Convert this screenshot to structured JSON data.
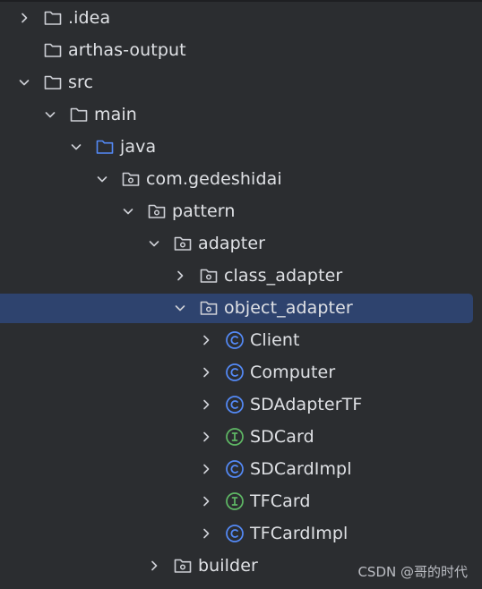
{
  "tree": [
    {
      "label": ".idea",
      "icon": "folder-icon",
      "chevron": "right",
      "depth": 0
    },
    {
      "label": "arthas-output",
      "icon": "folder-icon",
      "chevron": "none",
      "depth": 0
    },
    {
      "label": "src",
      "icon": "folder-icon",
      "chevron": "down",
      "depth": 0
    },
    {
      "label": "main",
      "icon": "folder-icon",
      "chevron": "down",
      "depth": 1
    },
    {
      "label": "java",
      "icon": "source-folder-icon",
      "chevron": "down",
      "depth": 2
    },
    {
      "label": "com.gedeshidai",
      "icon": "package-icon",
      "chevron": "down",
      "depth": 3
    },
    {
      "label": "pattern",
      "icon": "package-icon",
      "chevron": "down",
      "depth": 4
    },
    {
      "label": "adapter",
      "icon": "package-icon",
      "chevron": "down",
      "depth": 5
    },
    {
      "label": "class_adapter",
      "icon": "package-icon",
      "chevron": "right",
      "depth": 6
    },
    {
      "label": "object_adapter",
      "icon": "package-icon",
      "chevron": "down",
      "depth": 6,
      "selected": true
    },
    {
      "label": "Client",
      "icon": "class-icon",
      "chevron": "right",
      "depth": 7
    },
    {
      "label": "Computer",
      "icon": "class-icon",
      "chevron": "right",
      "depth": 7
    },
    {
      "label": "SDAdapterTF",
      "icon": "class-icon",
      "chevron": "right",
      "depth": 7
    },
    {
      "label": "SDCard",
      "icon": "interface-icon",
      "chevron": "right",
      "depth": 7
    },
    {
      "label": "SDCardImpl",
      "icon": "class-icon",
      "chevron": "right",
      "depth": 7
    },
    {
      "label": "TFCard",
      "icon": "interface-icon",
      "chevron": "right",
      "depth": 7
    },
    {
      "label": "TFCardImpl",
      "icon": "class-icon",
      "chevron": "right",
      "depth": 7
    },
    {
      "label": "builder",
      "icon": "package-icon",
      "chevron": "right",
      "depth": 5
    }
  ],
  "watermark": "CSDN @哥的时代",
  "colors": {
    "background": "#2b2d30",
    "selection": "#2e436e",
    "text": "#dfe1e5",
    "folder": "#ced0d6",
    "source_folder": "#548af7",
    "class_icon": "#548af7",
    "interface_icon": "#5fb865"
  }
}
